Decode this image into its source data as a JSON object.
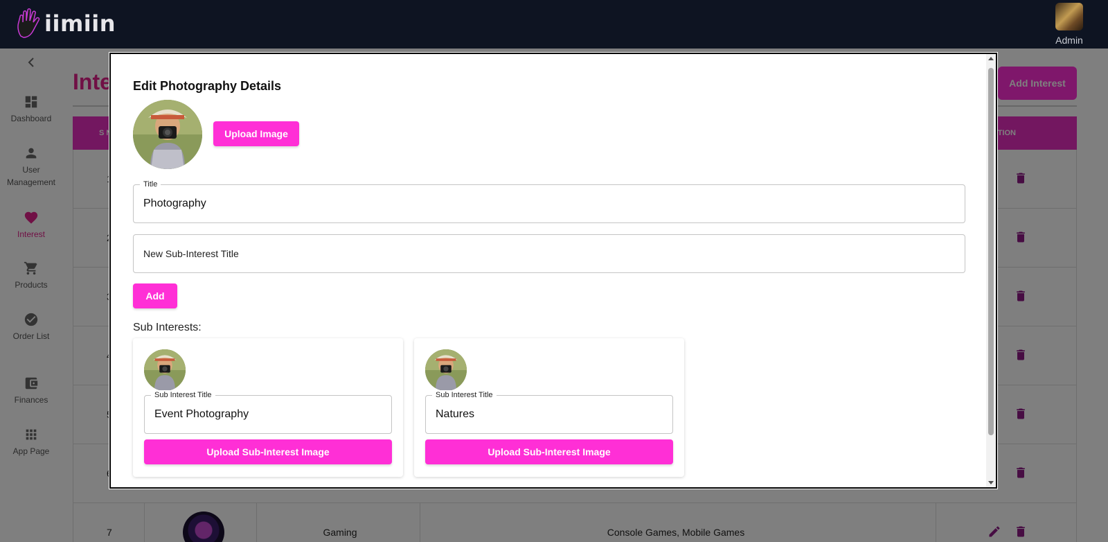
{
  "app": {
    "brand": "iimiin",
    "user_label": "Admin"
  },
  "sidebar": {
    "items": [
      {
        "label": "Dashboard",
        "icon": "dashboard-icon"
      },
      {
        "label": "User Management",
        "icon": "person-icon"
      },
      {
        "label": "Interest",
        "icon": "heart-icon",
        "active": true
      },
      {
        "label": "Products",
        "icon": "cart-icon"
      },
      {
        "label": "Order List",
        "icon": "check-circle-icon"
      },
      {
        "label": "Finances",
        "icon": "wallet-icon"
      },
      {
        "label": "App Page",
        "icon": "grid-icon"
      }
    ]
  },
  "page": {
    "title_visible": "Inte",
    "add_button": "Add Interest",
    "table": {
      "header_sn": "S N",
      "header_action": "CTION",
      "row_numbers": [
        "1",
        "2",
        "3",
        "4",
        "5",
        "6",
        "7"
      ],
      "last_row": {
        "number": "7",
        "name": "Gaming",
        "sub_interests": "Console Games, Mobile Games"
      }
    }
  },
  "modal": {
    "title": "Edit Photography Details",
    "upload_button": "Upload Image",
    "title_field": {
      "label": "Title",
      "value": "Photography"
    },
    "new_sub_field": {
      "placeholder": "New Sub-Interest Title"
    },
    "add_button": "Add",
    "sub_heading": "Sub Interests:",
    "sub_interests": [
      {
        "label": "Sub Interest Title",
        "value": "Event Photography",
        "button": "Upload Sub-Interest Image"
      },
      {
        "label": "Sub Interest Title",
        "value": "Natures",
        "button": "Upload Sub-Interest Image"
      }
    ]
  },
  "colors": {
    "accent": "#ff2fd6",
    "topbar": "#0e1422",
    "active_nav": "#e0218a",
    "action_icon": "#8e1a87"
  }
}
